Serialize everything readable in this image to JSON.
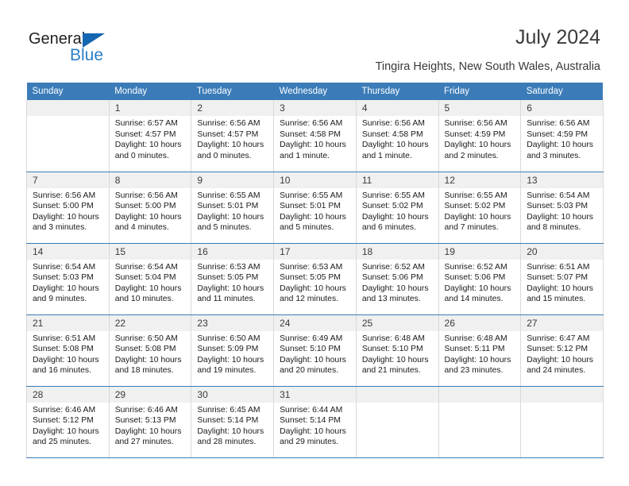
{
  "brand": {
    "name_dark": "General",
    "name_blue": "Blue",
    "triangle_color": "#1566b0",
    "blue_color": "#2b7fc6"
  },
  "header": {
    "title": "July 2024",
    "subtitle": "Tingira Heights, New South Wales, Australia"
  },
  "colors": {
    "header_row_bg": "#3b7cb8",
    "header_row_text": "#ffffff",
    "daynum_bg": "#f0f0f0",
    "cell_border": "#d9d9d9",
    "week_separator": "#3b7cb8",
    "body_text": "#1a1a1a"
  },
  "weekday_headers": [
    "Sunday",
    "Monday",
    "Tuesday",
    "Wednesday",
    "Thursday",
    "Friday",
    "Saturday"
  ],
  "labels": {
    "sunrise_prefix": "Sunrise:",
    "sunset_prefix": "Sunset:",
    "daylight_prefix": "Daylight:"
  },
  "weeks": [
    [
      {
        "day": "",
        "sunrise": "",
        "sunset": "",
        "daylight_1": "",
        "daylight_2": ""
      },
      {
        "day": "1",
        "sunrise": "Sunrise: 6:57 AM",
        "sunset": "Sunset: 4:57 PM",
        "daylight_1": "Daylight: 10 hours",
        "daylight_2": "and 0 minutes."
      },
      {
        "day": "2",
        "sunrise": "Sunrise: 6:56 AM",
        "sunset": "Sunset: 4:57 PM",
        "daylight_1": "Daylight: 10 hours",
        "daylight_2": "and 0 minutes."
      },
      {
        "day": "3",
        "sunrise": "Sunrise: 6:56 AM",
        "sunset": "Sunset: 4:58 PM",
        "daylight_1": "Daylight: 10 hours",
        "daylight_2": "and 1 minute."
      },
      {
        "day": "4",
        "sunrise": "Sunrise: 6:56 AM",
        "sunset": "Sunset: 4:58 PM",
        "daylight_1": "Daylight: 10 hours",
        "daylight_2": "and 1 minute."
      },
      {
        "day": "5",
        "sunrise": "Sunrise: 6:56 AM",
        "sunset": "Sunset: 4:59 PM",
        "daylight_1": "Daylight: 10 hours",
        "daylight_2": "and 2 minutes."
      },
      {
        "day": "6",
        "sunrise": "Sunrise: 6:56 AM",
        "sunset": "Sunset: 4:59 PM",
        "daylight_1": "Daylight: 10 hours",
        "daylight_2": "and 3 minutes."
      }
    ],
    [
      {
        "day": "7",
        "sunrise": "Sunrise: 6:56 AM",
        "sunset": "Sunset: 5:00 PM",
        "daylight_1": "Daylight: 10 hours",
        "daylight_2": "and 3 minutes."
      },
      {
        "day": "8",
        "sunrise": "Sunrise: 6:56 AM",
        "sunset": "Sunset: 5:00 PM",
        "daylight_1": "Daylight: 10 hours",
        "daylight_2": "and 4 minutes."
      },
      {
        "day": "9",
        "sunrise": "Sunrise: 6:55 AM",
        "sunset": "Sunset: 5:01 PM",
        "daylight_1": "Daylight: 10 hours",
        "daylight_2": "and 5 minutes."
      },
      {
        "day": "10",
        "sunrise": "Sunrise: 6:55 AM",
        "sunset": "Sunset: 5:01 PM",
        "daylight_1": "Daylight: 10 hours",
        "daylight_2": "and 5 minutes."
      },
      {
        "day": "11",
        "sunrise": "Sunrise: 6:55 AM",
        "sunset": "Sunset: 5:02 PM",
        "daylight_1": "Daylight: 10 hours",
        "daylight_2": "and 6 minutes."
      },
      {
        "day": "12",
        "sunrise": "Sunrise: 6:55 AM",
        "sunset": "Sunset: 5:02 PM",
        "daylight_1": "Daylight: 10 hours",
        "daylight_2": "and 7 minutes."
      },
      {
        "day": "13",
        "sunrise": "Sunrise: 6:54 AM",
        "sunset": "Sunset: 5:03 PM",
        "daylight_1": "Daylight: 10 hours",
        "daylight_2": "and 8 minutes."
      }
    ],
    [
      {
        "day": "14",
        "sunrise": "Sunrise: 6:54 AM",
        "sunset": "Sunset: 5:03 PM",
        "daylight_1": "Daylight: 10 hours",
        "daylight_2": "and 9 minutes."
      },
      {
        "day": "15",
        "sunrise": "Sunrise: 6:54 AM",
        "sunset": "Sunset: 5:04 PM",
        "daylight_1": "Daylight: 10 hours",
        "daylight_2": "and 10 minutes."
      },
      {
        "day": "16",
        "sunrise": "Sunrise: 6:53 AM",
        "sunset": "Sunset: 5:05 PM",
        "daylight_1": "Daylight: 10 hours",
        "daylight_2": "and 11 minutes."
      },
      {
        "day": "17",
        "sunrise": "Sunrise: 6:53 AM",
        "sunset": "Sunset: 5:05 PM",
        "daylight_1": "Daylight: 10 hours",
        "daylight_2": "and 12 minutes."
      },
      {
        "day": "18",
        "sunrise": "Sunrise: 6:52 AM",
        "sunset": "Sunset: 5:06 PM",
        "daylight_1": "Daylight: 10 hours",
        "daylight_2": "and 13 minutes."
      },
      {
        "day": "19",
        "sunrise": "Sunrise: 6:52 AM",
        "sunset": "Sunset: 5:06 PM",
        "daylight_1": "Daylight: 10 hours",
        "daylight_2": "and 14 minutes."
      },
      {
        "day": "20",
        "sunrise": "Sunrise: 6:51 AM",
        "sunset": "Sunset: 5:07 PM",
        "daylight_1": "Daylight: 10 hours",
        "daylight_2": "and 15 minutes."
      }
    ],
    [
      {
        "day": "21",
        "sunrise": "Sunrise: 6:51 AM",
        "sunset": "Sunset: 5:08 PM",
        "daylight_1": "Daylight: 10 hours",
        "daylight_2": "and 16 minutes."
      },
      {
        "day": "22",
        "sunrise": "Sunrise: 6:50 AM",
        "sunset": "Sunset: 5:08 PM",
        "daylight_1": "Daylight: 10 hours",
        "daylight_2": "and 18 minutes."
      },
      {
        "day": "23",
        "sunrise": "Sunrise: 6:50 AM",
        "sunset": "Sunset: 5:09 PM",
        "daylight_1": "Daylight: 10 hours",
        "daylight_2": "and 19 minutes."
      },
      {
        "day": "24",
        "sunrise": "Sunrise: 6:49 AM",
        "sunset": "Sunset: 5:10 PM",
        "daylight_1": "Daylight: 10 hours",
        "daylight_2": "and 20 minutes."
      },
      {
        "day": "25",
        "sunrise": "Sunrise: 6:48 AM",
        "sunset": "Sunset: 5:10 PM",
        "daylight_1": "Daylight: 10 hours",
        "daylight_2": "and 21 minutes."
      },
      {
        "day": "26",
        "sunrise": "Sunrise: 6:48 AM",
        "sunset": "Sunset: 5:11 PM",
        "daylight_1": "Daylight: 10 hours",
        "daylight_2": "and 23 minutes."
      },
      {
        "day": "27",
        "sunrise": "Sunrise: 6:47 AM",
        "sunset": "Sunset: 5:12 PM",
        "daylight_1": "Daylight: 10 hours",
        "daylight_2": "and 24 minutes."
      }
    ],
    [
      {
        "day": "28",
        "sunrise": "Sunrise: 6:46 AM",
        "sunset": "Sunset: 5:12 PM",
        "daylight_1": "Daylight: 10 hours",
        "daylight_2": "and 25 minutes."
      },
      {
        "day": "29",
        "sunrise": "Sunrise: 6:46 AM",
        "sunset": "Sunset: 5:13 PM",
        "daylight_1": "Daylight: 10 hours",
        "daylight_2": "and 27 minutes."
      },
      {
        "day": "30",
        "sunrise": "Sunrise: 6:45 AM",
        "sunset": "Sunset: 5:14 PM",
        "daylight_1": "Daylight: 10 hours",
        "daylight_2": "and 28 minutes."
      },
      {
        "day": "31",
        "sunrise": "Sunrise: 6:44 AM",
        "sunset": "Sunset: 5:14 PM",
        "daylight_1": "Daylight: 10 hours",
        "daylight_2": "and 29 minutes."
      },
      {
        "day": "",
        "sunrise": "",
        "sunset": "",
        "daylight_1": "",
        "daylight_2": ""
      },
      {
        "day": "",
        "sunrise": "",
        "sunset": "",
        "daylight_1": "",
        "daylight_2": ""
      },
      {
        "day": "",
        "sunrise": "",
        "sunset": "",
        "daylight_1": "",
        "daylight_2": ""
      }
    ]
  ]
}
